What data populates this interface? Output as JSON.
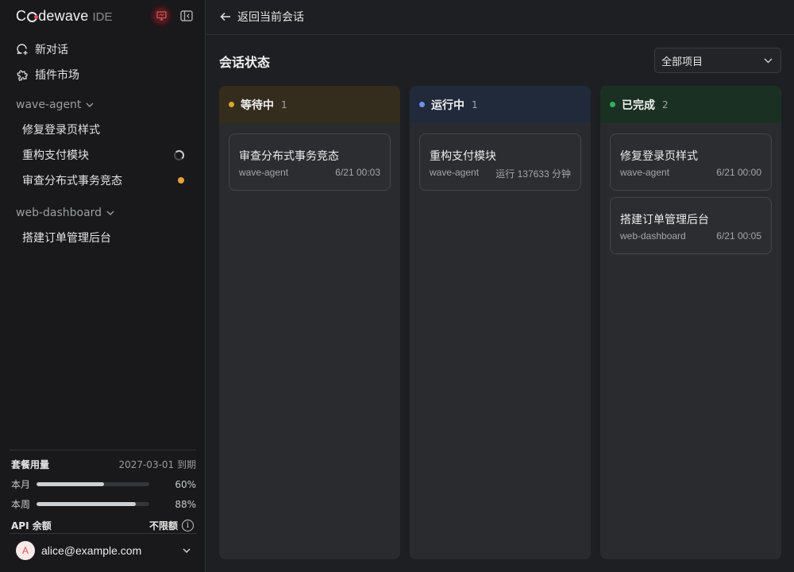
{
  "brand": {
    "name_pre": "C",
    "name_post": "dewave",
    "suffix": "IDE",
    "icons": [
      "monitor-icon",
      "sidebar-collapse-icon"
    ]
  },
  "nav": [
    {
      "label": "新对话",
      "icon": "new-chat-icon"
    },
    {
      "label": "插件市场",
      "icon": "puzzle-icon"
    }
  ],
  "groups": [
    {
      "name": "wave-agent",
      "sessions": [
        {
          "label": "修复登录页样式",
          "status": "none"
        },
        {
          "label": "重构支付模块",
          "status": "running-spinner"
        },
        {
          "label": "审查分布式事务竞态",
          "status": "waiting-dot"
        }
      ]
    },
    {
      "name": "web-dashboard",
      "sessions": [
        {
          "label": "搭建订单管理后台",
          "status": "none"
        }
      ]
    }
  ],
  "usage": {
    "title": "套餐用量",
    "expiry": "2027-03-01 到期",
    "rows": [
      {
        "label": "本月",
        "percent": 60,
        "percent_text": "60%"
      },
      {
        "label": "本周",
        "percent": 88,
        "percent_text": "88%"
      }
    ],
    "api_label": "API 余额",
    "api_value": "不限额",
    "info_glyph": "i"
  },
  "user": {
    "initial": "A",
    "email": "alice@example.com"
  },
  "topbar": {
    "back_label": "返回当前会话"
  },
  "main": {
    "title": "会话状态",
    "filter": "全部项目",
    "columns": [
      {
        "name": "等待中",
        "count": "1",
        "dot_color": "#d9a62a",
        "head_bg": "#342c1c",
        "cards": [
          {
            "title": "审查分布式事务竞态",
            "project": "wave-agent",
            "info": "6/21 00:03"
          }
        ]
      },
      {
        "name": "运行中",
        "count": "1",
        "dot_color": "#6f8fe8",
        "head_bg": "#212a3a",
        "cards": [
          {
            "title": "重构支付模块",
            "project": "wave-agent",
            "info": "运行 137633 分钟"
          }
        ]
      },
      {
        "name": "已完成",
        "count": "2",
        "dot_color": "#2fb35c",
        "head_bg": "#1a3023",
        "cards": [
          {
            "title": "修复登录页样式",
            "project": "wave-agent",
            "info": "6/21 00:00"
          },
          {
            "title": "搭建订单管理后台",
            "project": "web-dashboard",
            "info": "6/21 00:05"
          }
        ]
      }
    ]
  }
}
